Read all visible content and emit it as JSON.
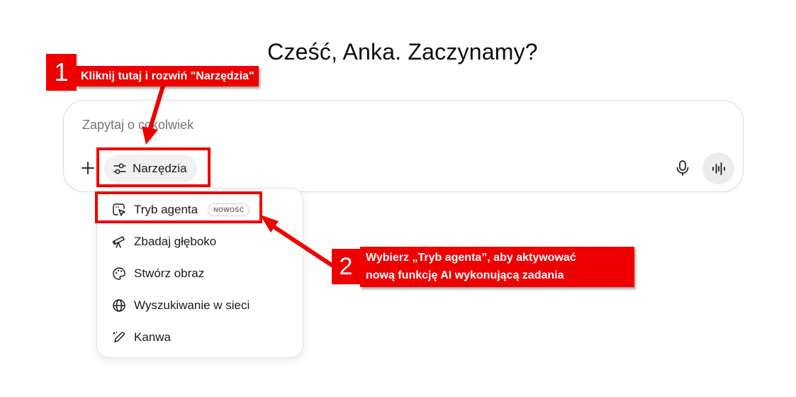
{
  "header": {
    "greeting": "Cześć, Anka. Zaczynamy?"
  },
  "composer": {
    "placeholder": "Zapytaj o cokolwiek",
    "tools_label": "Narzędzia"
  },
  "tools_menu": {
    "items": [
      {
        "label": "Tryb agenta",
        "badge": "NOWOŚĆ",
        "icon": "agent-cursor-icon"
      },
      {
        "label": "Zbadaj głęboko",
        "icon": "telescope-icon"
      },
      {
        "label": "Stwórz obraz",
        "icon": "palette-icon"
      },
      {
        "label": "Wyszukiwanie w sieci",
        "icon": "globe-icon"
      },
      {
        "label": "Kanwa",
        "icon": "pencil-icon"
      }
    ]
  },
  "annotations": {
    "step1": {
      "number": "1",
      "text": "Kliknij tutaj i rozwiń \"Narzędzia\""
    },
    "step2": {
      "number": "2",
      "line1": "Wybierz „Tryb agenta”, aby aktywować",
      "line2": "nową funkcję AI wykonującą zadania"
    },
    "color": "#ef0000"
  }
}
